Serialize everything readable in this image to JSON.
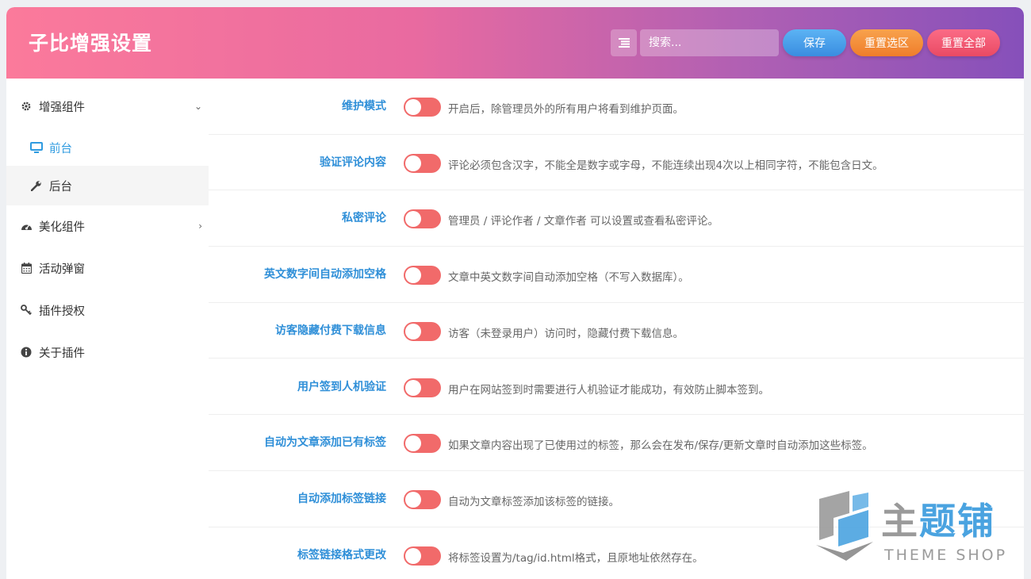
{
  "header": {
    "title": "子比增强设置",
    "search_placeholder": "搜索...",
    "save_label": "保存",
    "reset_section_label": "重置选区",
    "reset_all_label": "重置全部"
  },
  "sidebar": {
    "items": [
      {
        "label": "增强组件",
        "icon": "gear-icon",
        "arrow": "⌄"
      },
      {
        "label": "前台",
        "icon": "monitor-icon"
      },
      {
        "label": "后台",
        "icon": "wrench-icon"
      },
      {
        "label": "美化组件",
        "icon": "palette-icon",
        "arrow": "›"
      },
      {
        "label": "活动弹窗",
        "icon": "calendar-icon"
      },
      {
        "label": "插件授权",
        "icon": "key-icon"
      },
      {
        "label": "关于插件",
        "icon": "info-icon"
      }
    ]
  },
  "settings": [
    {
      "label": "维护模式",
      "desc": "开启后，除管理员外的所有用户将看到维护页面。",
      "enabled": false
    },
    {
      "label": "验证评论内容",
      "desc": "评论必须包含汉字，不能全是数字或字母，不能连续出现4次以上相同字符，不能包含日文。",
      "enabled": false
    },
    {
      "label": "私密评论",
      "desc": "管理员 / 评论作者 / 文章作者 可以设置或查看私密评论。",
      "enabled": false
    },
    {
      "label": "英文数字间自动添加空格",
      "desc": "文章中英文数字间自动添加空格（不写入数据库）。",
      "enabled": false
    },
    {
      "label": "访客隐藏付费下载信息",
      "desc": "访客（未登录用户）访问时，隐藏付费下载信息。",
      "enabled": false
    },
    {
      "label": "用户签到人机验证",
      "desc": "用户在网站签到时需要进行人机验证才能成功，有效防止脚本签到。",
      "enabled": false
    },
    {
      "label": "自动为文章添加已有标签",
      "desc": "如果文章内容出现了已使用过的标签，那么会在发布/保存/更新文章时自动添加这些标签。",
      "enabled": false
    },
    {
      "label": "自动添加标签链接",
      "desc": "自动为文章标签添加该标签的链接。",
      "enabled": false
    },
    {
      "label": "标签链接格式更改",
      "desc": "将标签设置为/tag/id.html格式，且原地址依然存在。",
      "enabled": false
    }
  ],
  "watermark": {
    "cn_1": "主",
    "cn_2": "题铺",
    "en": "THEME SHOP"
  },
  "colors": {
    "accent_blue": "#2f8fd8",
    "toggle_off": "#f16a6a",
    "header_gradient_start": "#fb7a9b",
    "header_gradient_end": "#8650ba"
  }
}
